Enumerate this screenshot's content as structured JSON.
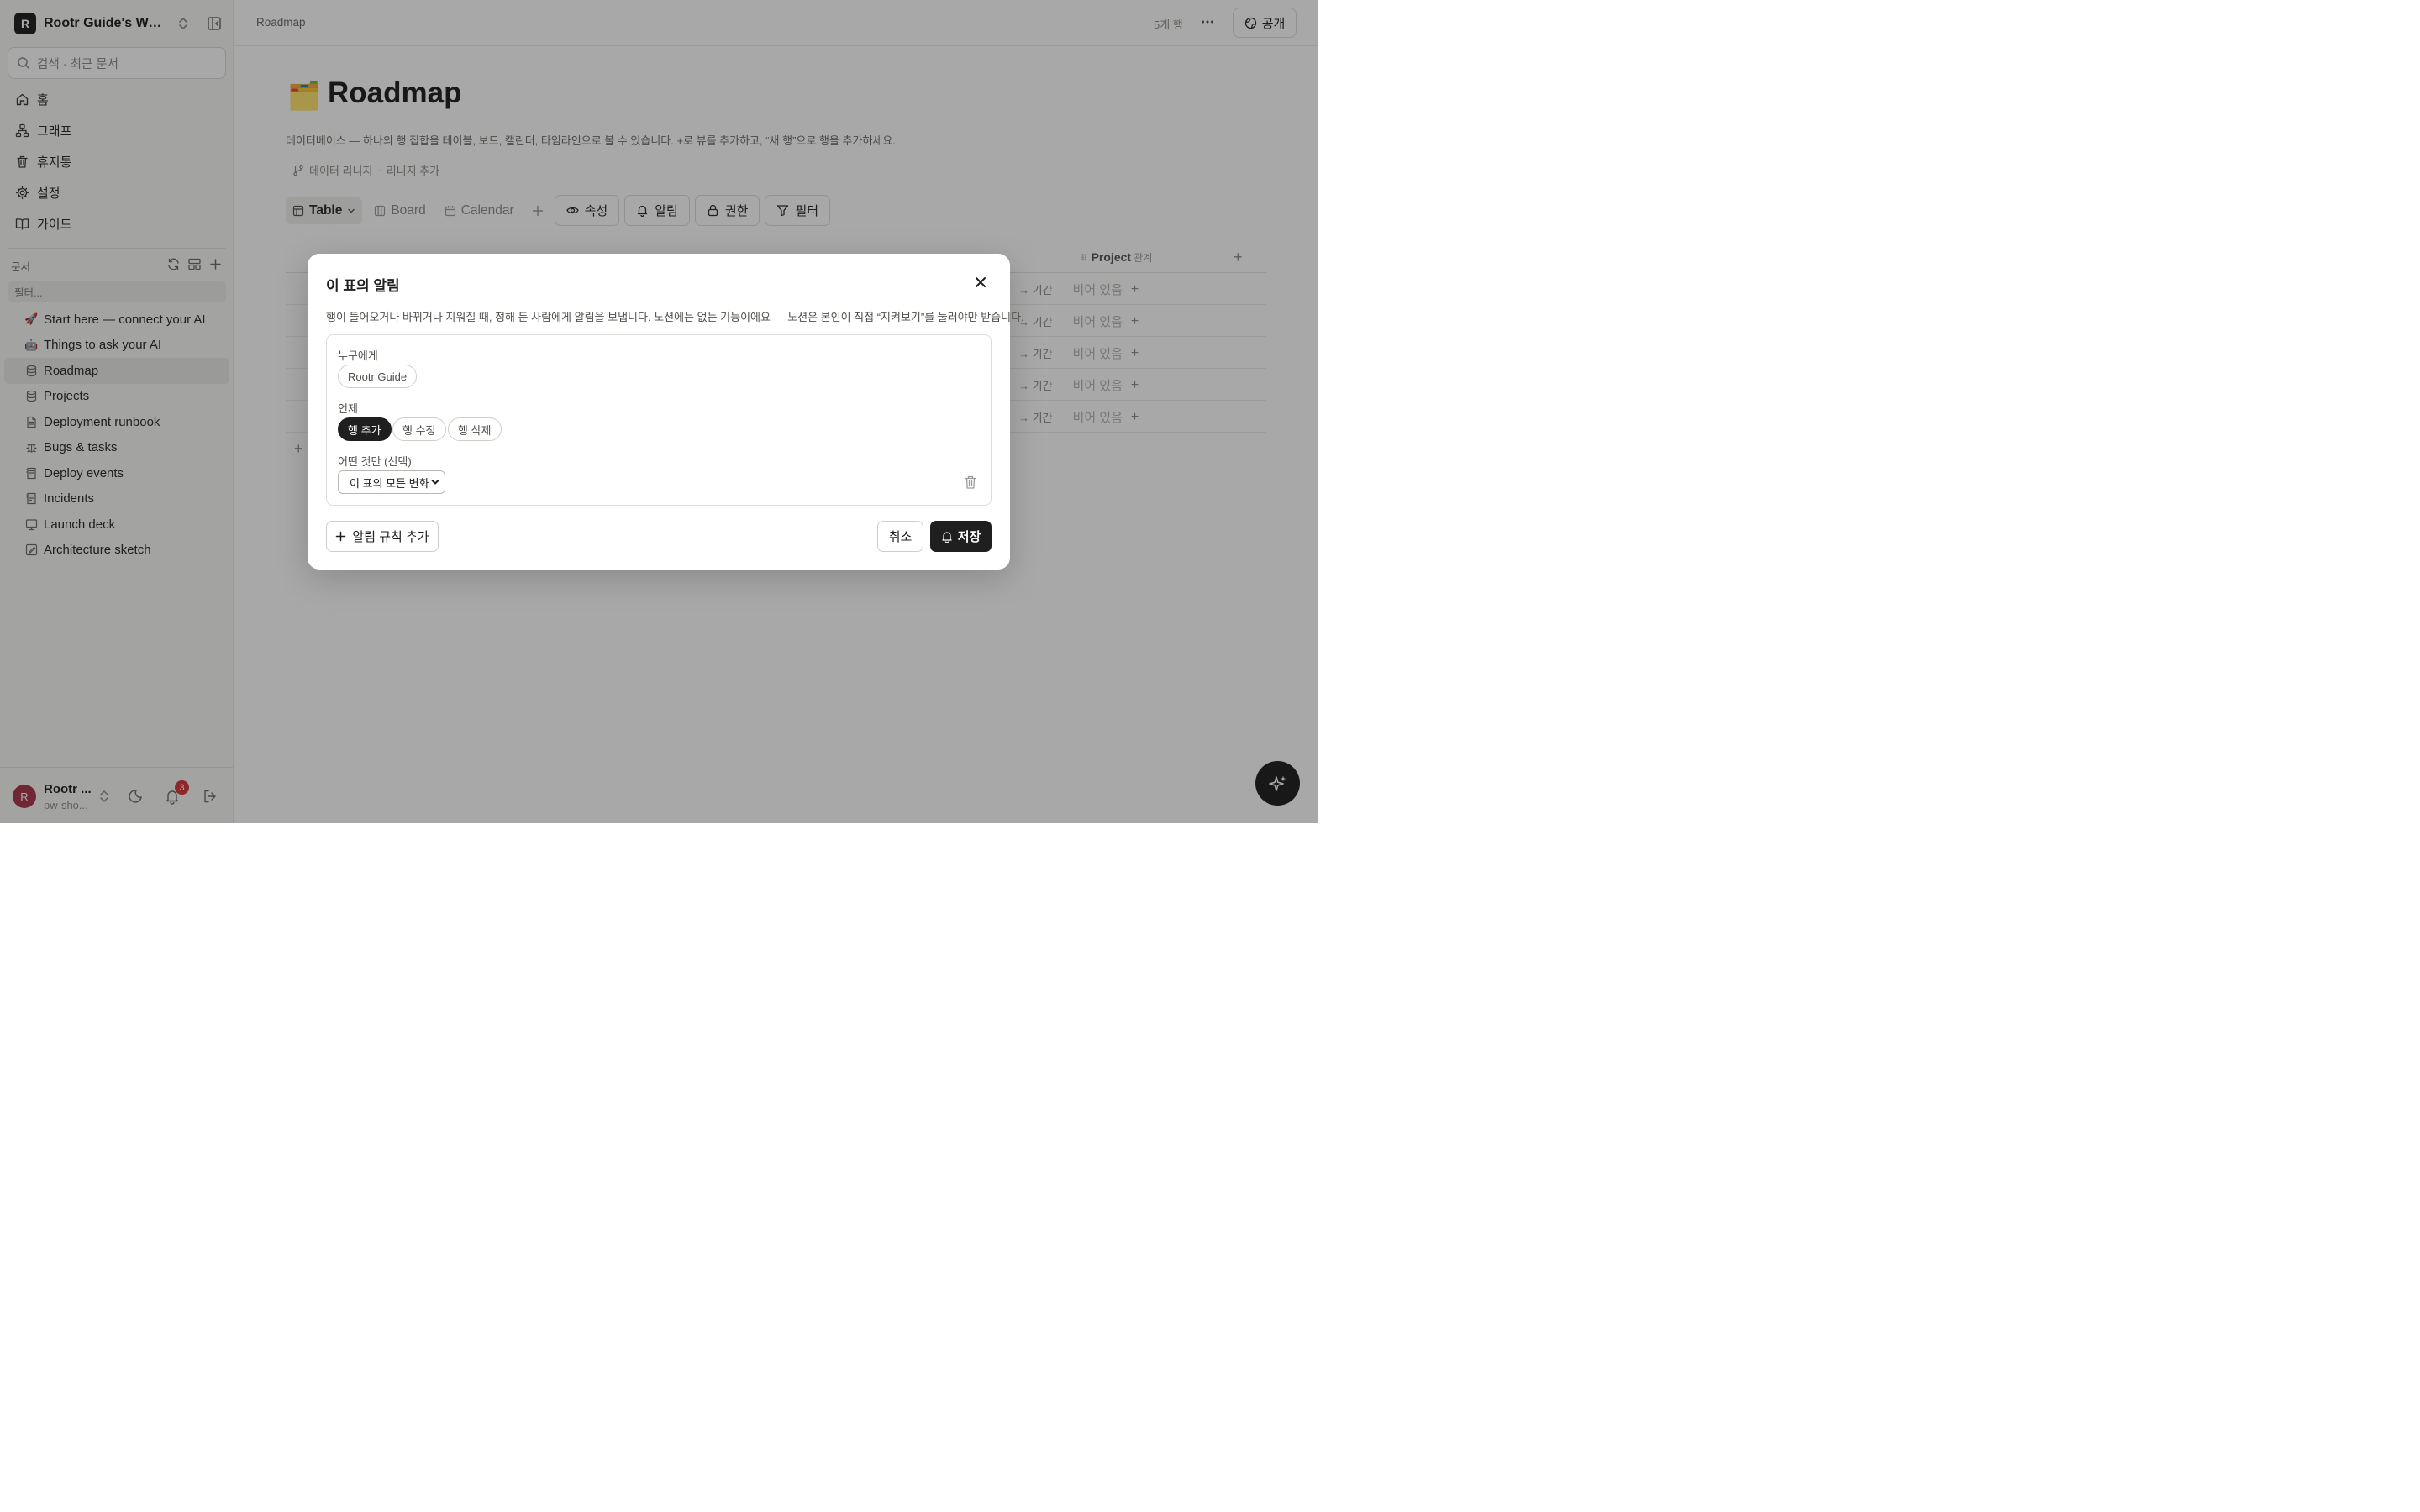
{
  "workspace": {
    "initial": "R",
    "name": "Rootr Guide's Wor..."
  },
  "search": {
    "placeholder": "검색 · 최근 문서"
  },
  "nav": [
    {
      "label": "홈",
      "icon": "home-icon"
    },
    {
      "label": "그래프",
      "icon": "graph-icon"
    },
    {
      "label": "휴지통",
      "icon": "trash-icon"
    },
    {
      "label": "설정",
      "icon": "gear-icon"
    },
    {
      "label": "가이드",
      "icon": "book-icon"
    }
  ],
  "docs": {
    "header": "문서",
    "filter_placeholder": "필터...",
    "items": [
      {
        "label": "Start here — connect your AI",
        "icon": "rocket-icon",
        "glyph": "🚀"
      },
      {
        "label": "Things to ask your AI",
        "icon": "robot-icon",
        "glyph": "🤖"
      },
      {
        "label": "Roadmap",
        "icon": "database-icon",
        "glyph": ""
      },
      {
        "label": "Projects",
        "icon": "database-icon",
        "glyph": ""
      },
      {
        "label": "Deployment runbook",
        "icon": "document-icon",
        "glyph": ""
      },
      {
        "label": "Bugs & tasks",
        "icon": "bug-icon",
        "glyph": ""
      },
      {
        "label": "Deploy events",
        "icon": "log-icon",
        "glyph": ""
      },
      {
        "label": "Incidents",
        "icon": "log-icon",
        "glyph": ""
      },
      {
        "label": "Launch deck",
        "icon": "presentation-icon",
        "glyph": ""
      },
      {
        "label": "Architecture sketch",
        "icon": "sketch-icon",
        "glyph": ""
      }
    ],
    "active_index": 2
  },
  "user": {
    "initial": "R",
    "name": "Rootr ...",
    "sub": "pw-sho...",
    "notifications": "3"
  },
  "topbar": {
    "breadcrumb": "Roadmap",
    "row_count": "5개 행",
    "public_label": "공개"
  },
  "page": {
    "icon": "🗂️",
    "title": "Roadmap",
    "description": "데이터베이스 — 하나의 행 집합을 테이블, 보드, 캘린더, 타임라인으로 볼 수 있습니다. +로 뷰를 추가하고, “새 행”으로 행을 추가하세요.",
    "lineage": "데이터 리니지",
    "lineage_sep": "·",
    "lineage_add": "리니지 추가"
  },
  "views": {
    "tabs": [
      {
        "label": "Table",
        "icon": "table-icon"
      },
      {
        "label": "Board",
        "icon": "board-icon"
      },
      {
        "label": "Calendar",
        "icon": "calendar-icon"
      }
    ],
    "buttons": [
      {
        "label": "속성",
        "icon": "eye-icon"
      },
      {
        "label": "알림",
        "icon": "bell-icon"
      },
      {
        "label": "권한",
        "icon": "lock-icon"
      },
      {
        "label": "필터",
        "icon": "filter-icon"
      }
    ]
  },
  "table": {
    "project_col": "Project",
    "project_col_type": "관계",
    "rows": [
      {
        "a": "간",
        "b": "→ 기간",
        "c": "비어 있음"
      },
      {
        "a": "간",
        "b": "→ 기간",
        "c": "비어 있음"
      },
      {
        "a": "간",
        "b": "→ 기간",
        "c": "비어 있음"
      },
      {
        "a": "간",
        "b": "→ 기간",
        "c": "비어 있음"
      },
      {
        "a": "간",
        "b": "→ 기간",
        "c": "비어 있음"
      }
    ]
  },
  "modal": {
    "title": "이 표의 알림",
    "description": "행이 들어오거나 바뀌거나 지워질 때, 정해 둔 사람에게 알림을 보냅니다. 노션에는 없는 기능이에요 — 노션은 본인이 직접 “지켜보기”를 눌러야만 받습니다.",
    "to_label": "누구에게",
    "recipient": "Rootr Guide",
    "when_label": "언제",
    "triggers": [
      {
        "label": "행 추가",
        "selected": true
      },
      {
        "label": "행 수정",
        "selected": false
      },
      {
        "label": "행 삭제",
        "selected": false
      }
    ],
    "scope_label": "어떤 것만 (선택)",
    "scope_value": "이 표의 모든 변화",
    "add_rule_label": "알림 규칙 추가",
    "cancel_label": "취소",
    "save_label": "저장"
  }
}
